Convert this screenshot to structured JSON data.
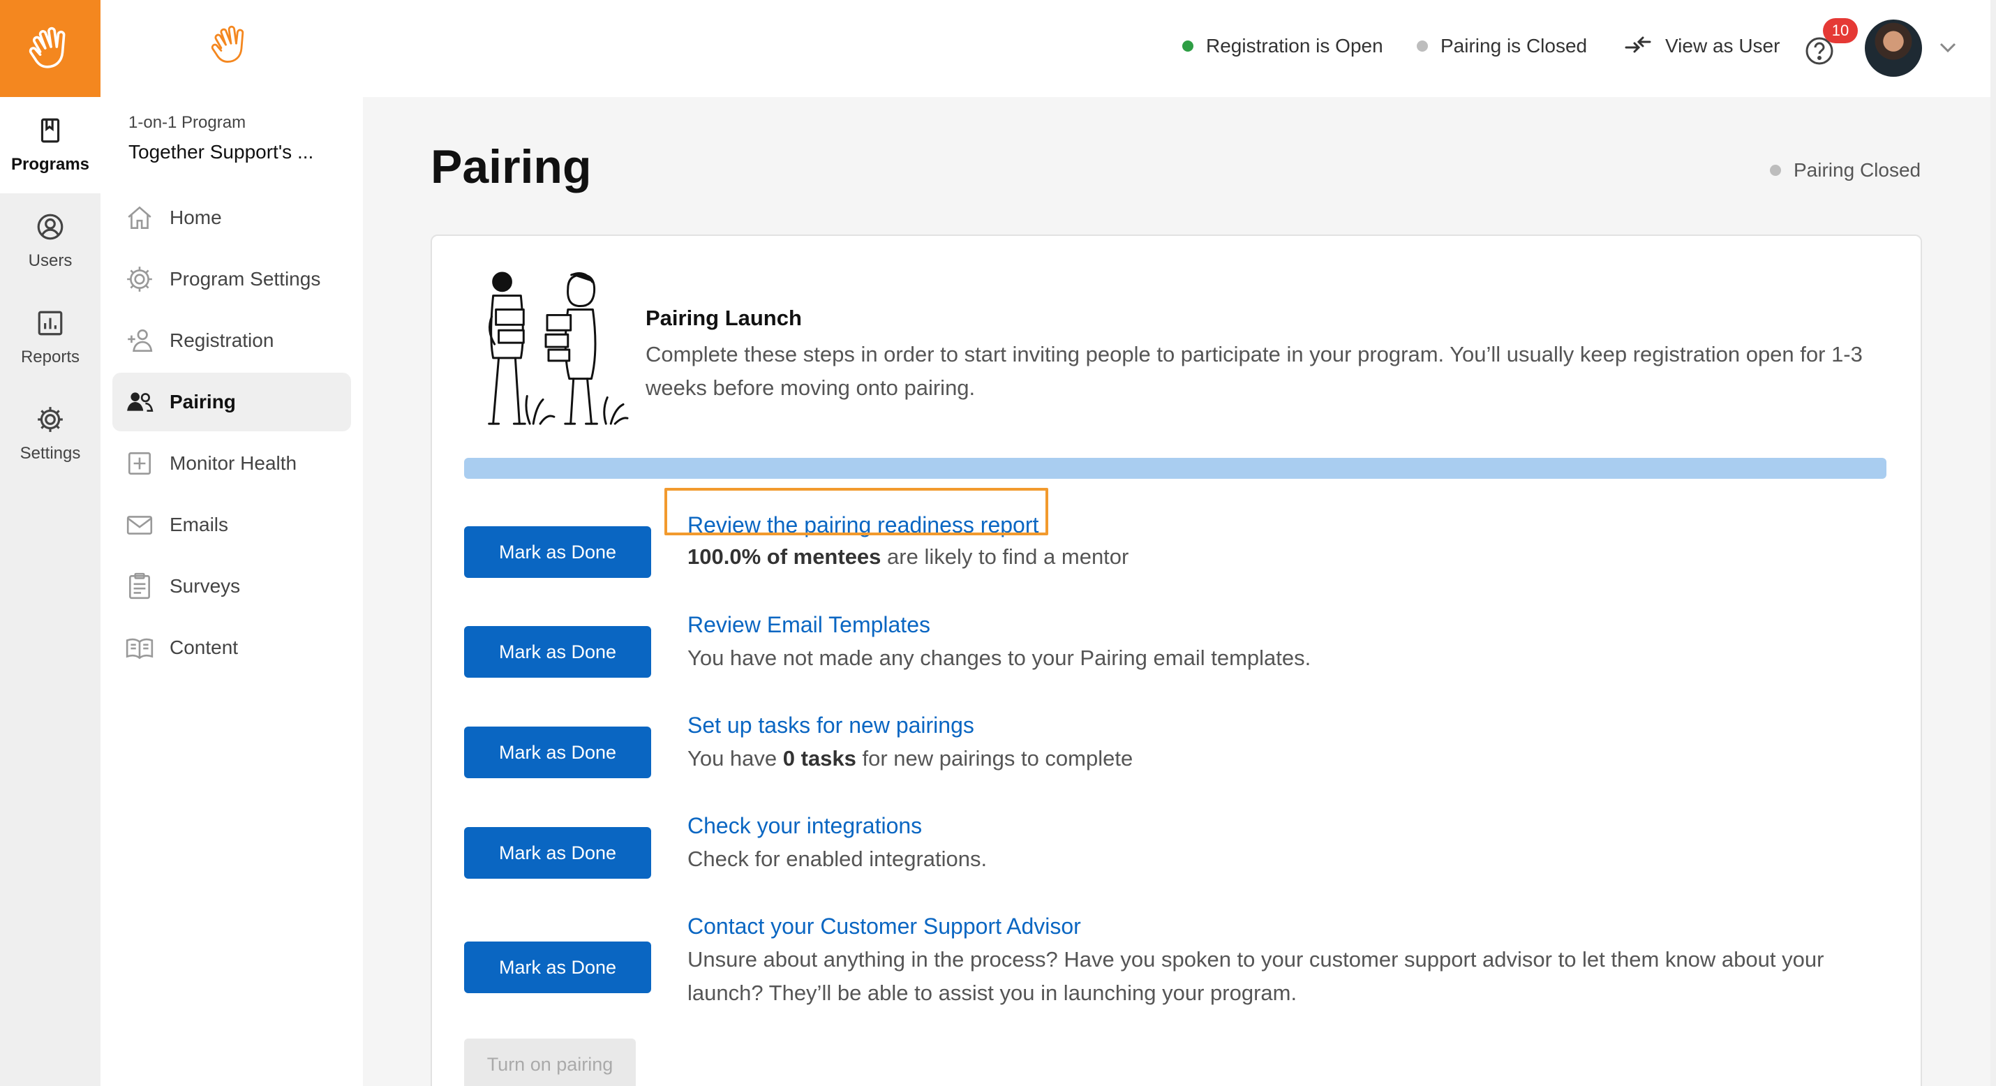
{
  "rail": {
    "items": [
      {
        "label": "Programs",
        "icon": "bookmark-icon"
      },
      {
        "label": "Users",
        "icon": "user-circle-icon"
      },
      {
        "label": "Reports",
        "icon": "bar-chart-icon"
      },
      {
        "label": "Settings",
        "icon": "gear-icon"
      }
    ]
  },
  "sidebar": {
    "program_type": "1-on-1 Program",
    "program_name": "Together Support's ...",
    "items": [
      {
        "label": "Home",
        "icon": "home-icon"
      },
      {
        "label": "Program Settings",
        "icon": "gear-icon"
      },
      {
        "label": "Registration",
        "icon": "add-person-icon"
      },
      {
        "label": "Pairing",
        "icon": "people-icon"
      },
      {
        "label": "Monitor Health",
        "icon": "plus-square-icon"
      },
      {
        "label": "Emails",
        "icon": "envelope-icon"
      },
      {
        "label": "Surveys",
        "icon": "clipboard-icon"
      },
      {
        "label": "Content",
        "icon": "book-icon"
      }
    ]
  },
  "topbar": {
    "registration_status": "Registration is Open",
    "pairing_status": "Pairing is Closed",
    "view_as_user": "View as User",
    "notification_count": "10"
  },
  "colors": {
    "brand": "#f4871f",
    "primary": "#0a66c2",
    "open": "#2e9e44",
    "closed": "#bdbdbd",
    "highlight": "#f29a2e"
  },
  "page": {
    "title": "Pairing",
    "status": "Pairing Closed"
  },
  "launch": {
    "title": "Pairing Launch",
    "description": "Complete these steps in order to start inviting people to participate in your program. You’ll usually keep registration open for 1-3 weeks before moving onto pairing.",
    "progress": 1.0
  },
  "steps": [
    {
      "button": "Mark as Done",
      "title": "Review the pairing readiness report",
      "desc_bold": "100.0% of mentees",
      "desc_rest": " are likely to find a mentor"
    },
    {
      "button": "Mark as Done",
      "title": "Review Email Templates",
      "description": "You have not made any changes to your Pairing email templates."
    },
    {
      "button": "Mark as Done",
      "title": "Set up tasks for new pairings",
      "desc_pre": "You have ",
      "desc_bold": "0 tasks",
      "desc_rest": " for new pairings to complete"
    },
    {
      "button": "Mark as Done",
      "title": "Check your integrations",
      "description": "Check for enabled integrations."
    },
    {
      "button": "Mark as Done",
      "title": "Contact your Customer Support Advisor",
      "description": "Unsure about anything in the process? Have you spoken to your customer support advisor to let them know about your launch? They’ll be able to assist you in launching your program."
    }
  ],
  "turn_on_label": "Turn on pairing"
}
